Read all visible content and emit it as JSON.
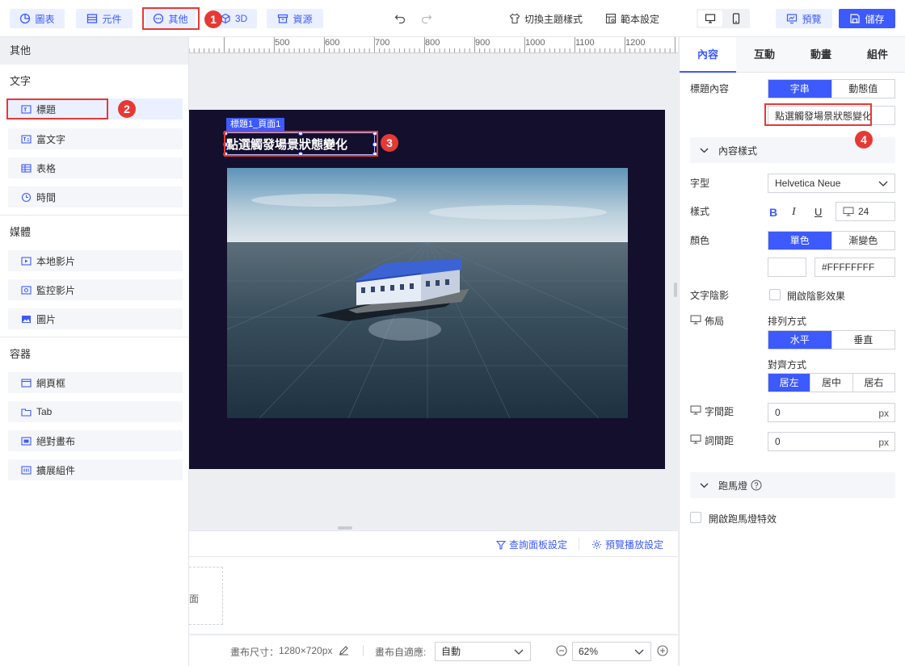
{
  "toolbar": {
    "chart": "圖表",
    "component": "元件",
    "other": "其他",
    "threed": "3D",
    "resource": "資源",
    "switch_theme": "切換主題樣式",
    "template_settings": "範本設定",
    "preview": "預覽",
    "save": "儲存"
  },
  "annotations": {
    "n1": "1",
    "n2": "2",
    "n3": "3",
    "n4": "4"
  },
  "left_panel": {
    "header": "其他",
    "sections": {
      "text": "文字",
      "media": "媒體",
      "container": "容器"
    },
    "text_items": [
      {
        "label": "標題",
        "icon": "title-icon"
      },
      {
        "label": "富文字",
        "icon": "rich-text-icon"
      },
      {
        "label": "表格",
        "icon": "table-icon"
      },
      {
        "label": "時間",
        "icon": "clock-icon"
      }
    ],
    "media_items": [
      {
        "label": "本地影片",
        "icon": "video-icon"
      },
      {
        "label": "監控影片",
        "icon": "monitor-video-icon"
      },
      {
        "label": "圖片",
        "icon": "image-icon"
      }
    ],
    "container_items": [
      {
        "label": "網頁框",
        "icon": "iframe-icon"
      },
      {
        "label": "Tab",
        "icon": "tab-icon"
      },
      {
        "label": "絕對畫布",
        "icon": "absolute-canvas-icon"
      },
      {
        "label": "擴展組件",
        "icon": "extension-icon"
      }
    ]
  },
  "ruler": {
    "marks": [
      "500",
      "600",
      "700",
      "800",
      "900",
      "1000",
      "1100",
      "1200"
    ]
  },
  "stage": {
    "element_tag": "標題1_頁面1",
    "title_text": "點選觸發場景狀態變化"
  },
  "bottom": {
    "query_panel_settings": "查詢面板設定",
    "preview_play_settings": "預覽播放設定",
    "page_card_partial": "面",
    "canvas_size_label": "畫布尺寸：",
    "canvas_size_value": "1280×720px",
    "canvas_fit_label": "畫布自適應:",
    "canvas_fit_value": "自動",
    "zoom_value": "62%"
  },
  "right_panel": {
    "tabs": [
      "內容",
      "互動",
      "動畫",
      "組件"
    ],
    "title_content_label": "標題內容",
    "source_options": [
      "字串",
      "動態值"
    ],
    "title_value": "點選觸發場景狀態變化",
    "content_style_label": "內容樣式",
    "font_label": "字型",
    "font_value": "Helvetica Neue",
    "style_label": "樣式",
    "bold_glyph": "B",
    "italic_glyph": "I",
    "underline_glyph": "U",
    "font_size": "24",
    "color_label": "顏色",
    "color_options": [
      "單色",
      "漸變色"
    ],
    "color_value": "#FFFFFFFF",
    "shadow_label": "文字陰影",
    "shadow_checkbox": "開啟陰影效果",
    "layout_label": "佈局",
    "arrange_label": "排列方式",
    "arrange_options": [
      "水平",
      "垂直"
    ],
    "align_label": "對齊方式",
    "align_options": [
      "居左",
      "居中",
      "居右"
    ],
    "letter_spacing_label": "字間距",
    "letter_spacing_value": "0",
    "word_spacing_label": "詞間距",
    "word_spacing_value": "0",
    "unit": "px",
    "marquee_label": "跑馬燈",
    "marquee_checkbox": "開啟跑馬燈特效"
  },
  "colors": {
    "accent": "#3d5afe",
    "annotation_red": "#e53935",
    "stage_bg": "#130f2d",
    "selected_item_bg": "#eaf0ff"
  }
}
